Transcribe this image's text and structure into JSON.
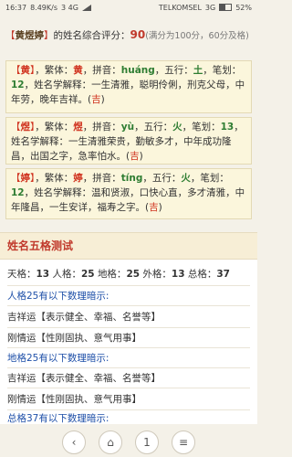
{
  "status": {
    "time": "16:37",
    "speed": "8.49K/s",
    "carrier": "TELKOMSEL",
    "net_left": "3",
    "net_left_type": "4G",
    "net_right": "3G",
    "battery": "52%",
    "battery_level": 0.52
  },
  "summary": {
    "open": "【",
    "name": "黄煜婷",
    "close": "】",
    "text": "的姓名综合评分：",
    "score": "90",
    "note": "(满分为100分，60分及格)"
  },
  "chars": [
    {
      "char": "黄",
      "trad_label": "繁体：",
      "trad": "黄",
      "pinyin_label": "拼音：",
      "pinyin": "huáng",
      "wuxing_label": "五行：",
      "wuxing": "土",
      "strokes_label": "笔划：",
      "strokes": "12",
      "meaning_label": "姓名学解释：",
      "meaning": "一生清雅，聪明伶俐，刑克父母，中年劳，晚年吉祥。",
      "luck": "吉"
    },
    {
      "char": "煜",
      "trad_label": "繁体：",
      "trad": "煜",
      "pinyin_label": "拼音：",
      "pinyin": "yù",
      "wuxing_label": "五行：",
      "wuxing": "火",
      "strokes_label": "笔划：",
      "strokes": "13",
      "meaning_label": "姓名学解释：",
      "meaning": "一生清雅荣贵，勤敏多才，中年成功隆昌，出国之字，急率怕水。",
      "luck": "吉"
    },
    {
      "char": "婷",
      "trad_label": "繁体：",
      "trad": "婷",
      "pinyin_label": "拼音：",
      "pinyin": "tíng",
      "wuxing_label": "五行：",
      "wuxing": "火",
      "strokes_label": "笔划：",
      "strokes": "12",
      "meaning_label": "姓名学解释：",
      "meaning": "温和贤淑，口快心直，多才清雅，中年隆昌，一生安详，福寿之字。",
      "luck": "吉"
    }
  ],
  "section_title": "姓名五格测试",
  "wuge": {
    "tian_label": "天格：",
    "tian": "13",
    "ren_label": "人格：",
    "ren": "25",
    "di_label": "地格：",
    "di": "25",
    "wai_label": "外格：",
    "wai": "13",
    "zong_label": "总格：",
    "zong": "37"
  },
  "hints": [
    {
      "title": "人格25有以下数理暗示:"
    },
    {
      "line": "吉祥运【表示健全、幸福、名誉等】"
    },
    {
      "line": "刚情运【性刚固执、意气用事】"
    },
    {
      "title": "地格25有以下数理暗示:"
    },
    {
      "line": "吉祥运【表示健全、幸福、名誉等】"
    },
    {
      "line": "刚情运【性刚固执、意气用事】"
    },
    {
      "title": "总格37有以下数理暗示:"
    }
  ],
  "nav": {
    "back": "‹",
    "home": "⌂",
    "page": "1",
    "menu": "≡"
  }
}
